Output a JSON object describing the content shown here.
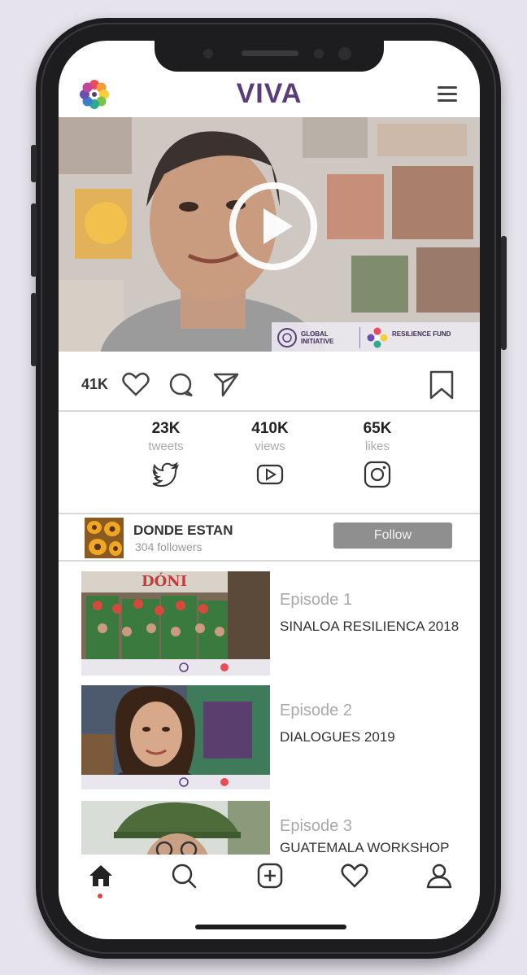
{
  "app": {
    "title": "VIVA"
  },
  "hero": {
    "logo_left_text": "GLOBAL INITIATIVE",
    "logo_right_text": "RESILIENCE FUND"
  },
  "post_actions": {
    "likes": "41K"
  },
  "stats": [
    {
      "count": "23K",
      "label": "tweets",
      "icon": "twitter-icon"
    },
    {
      "count": "410K",
      "label": "views",
      "icon": "youtube-icon"
    },
    {
      "count": "65K",
      "label": "likes",
      "icon": "instagram-icon"
    }
  ],
  "profile": {
    "name": "DONDE ESTAN",
    "followers": "304 followers",
    "follow_label": "Follow"
  },
  "episodes": [
    {
      "number": "Episode 1",
      "title": "SINALOA RESILIENCA 2018",
      "thumb_sign": "DÓNI"
    },
    {
      "number": "Episode 2",
      "title": "DIALOGUES 2019"
    },
    {
      "number": "Episode 3",
      "title": "GUATEMALA WORKSHOP"
    }
  ],
  "nav": [
    "home-icon",
    "search-icon",
    "add-icon",
    "heart-icon",
    "profile-icon"
  ],
  "colors": {
    "brand": "#5b3c7a",
    "follow_button": "#8f8f8f",
    "active_dot": "#e0473a"
  }
}
